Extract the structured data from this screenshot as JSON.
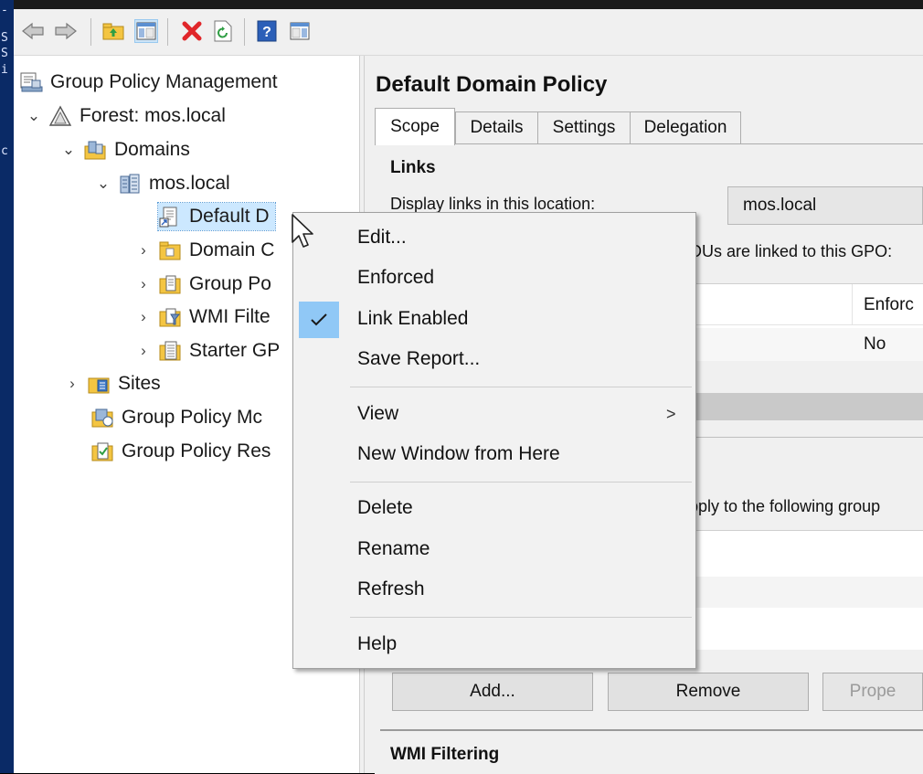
{
  "colors": {
    "accent": "#90c8f6",
    "selection": "#cce8ff",
    "delete_red": "#e0262a"
  },
  "left_strip_chars": [
    "-",
    "S",
    "S",
    "i",
    "c"
  ],
  "toolbar": {
    "icons": [
      "back-arrow-icon",
      "forward-arrow-icon",
      "up-folder-icon",
      "show-hide-console-tree-icon",
      "delete-icon",
      "refresh-icon",
      "help-icon",
      "show-hide-action-pane-icon"
    ]
  },
  "tree": {
    "root": "Group Policy Management",
    "forest": "Forest: mos.local",
    "domains": "Domains",
    "domain": "mos.local",
    "items": [
      "Default D",
      "Domain C",
      "Group Po",
      "WMI Filte",
      "Starter GP"
    ],
    "sites": "Sites",
    "modeling": "Group Policy Mc",
    "results": "Group Policy Res"
  },
  "details": {
    "title": "Default Domain Policy",
    "tabs": [
      "Scope",
      "Details",
      "Settings",
      "Delegation"
    ],
    "links_heading": "Links",
    "display_links_label": "Display links in this location:",
    "location_value": "mos.local",
    "linked_text": "OUs are linked to this GPO:",
    "enforced_header": "Enforc",
    "enforced_value": "No",
    "security_filter_text": "pply to the following group",
    "buttons": {
      "add": "Add...",
      "remove": "Remove",
      "properties": "Prope"
    },
    "wmi_heading": "WMI Filtering"
  },
  "context_menu": {
    "items": [
      "Edit...",
      "Enforced",
      "Link Enabled",
      "Save Report...",
      "View",
      "New Window from Here",
      "Delete",
      "Rename",
      "Refresh",
      "Help"
    ],
    "checked_item": "Link Enabled",
    "submenu_arrow": ">"
  }
}
